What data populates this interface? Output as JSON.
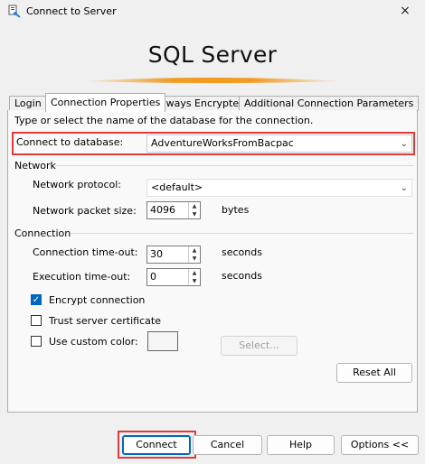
{
  "window": {
    "title": "Connect to Server",
    "close_icon": "×"
  },
  "header": {
    "product": "SQL Server"
  },
  "tabs": [
    {
      "label": "Login"
    },
    {
      "label": "Connection Properties"
    },
    {
      "label": "Always Encrypted"
    },
    {
      "label": "Additional Connection Parameters"
    }
  ],
  "panel": {
    "instructions": "Type or select the name of the database for the connection.",
    "database_label": "Connect to database:",
    "database_value": "AdventureWorksFromBacpac",
    "network_group": "Network",
    "protocol_label": "Network protocol:",
    "protocol_value": "<default>",
    "packet_label": "Network packet size:",
    "packet_value": "4096",
    "packet_unit": "bytes",
    "connection_group": "Connection",
    "timeout_label": "Connection time-out:",
    "timeout_value": "30",
    "timeout_unit": "seconds",
    "exec_label": "Execution time-out:",
    "exec_value": "0",
    "exec_unit": "seconds",
    "encrypt_label": "Encrypt connection",
    "encrypt_checked": true,
    "trust_label": "Trust server certificate",
    "trust_checked": false,
    "custom_color_label": "Use custom color:",
    "custom_color_checked": false,
    "select_button": "Select...",
    "reset_button": "Reset All"
  },
  "footer": {
    "connect": "Connect",
    "cancel": "Cancel",
    "help": "Help",
    "options": "Options <<"
  },
  "colors": {
    "accent": "#0067c0",
    "highlight": "#e03a3a",
    "swoosh": "#f39a1f"
  }
}
